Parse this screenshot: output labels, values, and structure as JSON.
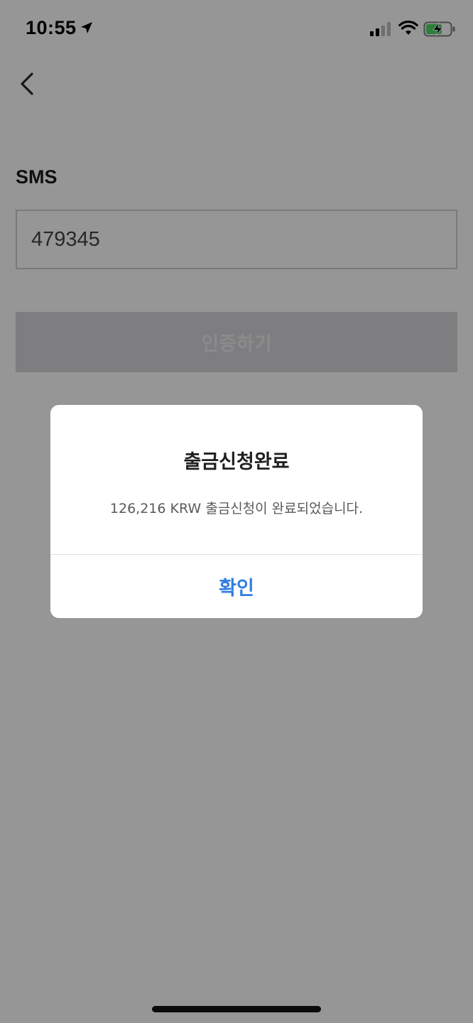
{
  "status_bar": {
    "time": "10:55",
    "location_icon": "location-arrow-icon",
    "signal_icon": "cellular-signal-icon",
    "wifi_icon": "wifi-icon",
    "battery_icon": "battery-charging-icon"
  },
  "header": {
    "back_icon": "chevron-left-icon"
  },
  "form": {
    "sms_label": "SMS",
    "sms_code_value": "479345",
    "verify_button_label": "인증하기"
  },
  "dialog": {
    "title": "출금신청완료",
    "message": "126,216 KRW 출금신청이 완료되었습니다.",
    "confirm_label": "확인"
  },
  "colors": {
    "accent": "#2f7de1",
    "overlay": "#000000",
    "disabled_button": "#d7d7db"
  }
}
